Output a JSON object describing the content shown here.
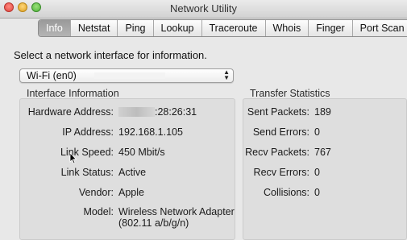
{
  "window": {
    "title": "Network Utility"
  },
  "tabs": [
    {
      "label": "Info",
      "active": true
    },
    {
      "label": "Netstat",
      "active": false
    },
    {
      "label": "Ping",
      "active": false
    },
    {
      "label": "Lookup",
      "active": false
    },
    {
      "label": "Traceroute",
      "active": false
    },
    {
      "label": "Whois",
      "active": false
    },
    {
      "label": "Finger",
      "active": false
    },
    {
      "label": "Port Scan",
      "active": false
    }
  ],
  "info": {
    "prompt": "Select a network interface for information.",
    "interface_select": {
      "value": "Wi-Fi (en0)"
    },
    "interface_section": {
      "title": "Interface Information",
      "hardware_address": {
        "label": "Hardware Address:",
        "value": ":28:26:31"
      },
      "ip_address": {
        "label": "IP Address:",
        "value": "192.168.1.105"
      },
      "link_speed": {
        "label": "Link Speed:",
        "value": "450 Mbit/s"
      },
      "link_status": {
        "label": "Link Status:",
        "value": "Active"
      },
      "vendor": {
        "label": "Vendor:",
        "value": "Apple"
      },
      "model": {
        "label": "Model:",
        "value_line1": "Wireless Network Adapter",
        "value_line2": "(802.11 a/b/g/n)"
      }
    },
    "transfer_section": {
      "title": "Transfer Statistics",
      "sent_packets": {
        "label": "Sent Packets:",
        "value": "189"
      },
      "send_errors": {
        "label": "Send Errors:",
        "value": "0"
      },
      "recv_packets": {
        "label": "Recv Packets:",
        "value": "767"
      },
      "recv_errors": {
        "label": "Recv Errors:",
        "value": "0"
      },
      "collisions": {
        "label": "Collisions:",
        "value": "0"
      }
    }
  },
  "icons": {
    "close": "close-button-icon",
    "minimize": "minimize-button-icon",
    "zoom": "zoom-button-icon",
    "select_arrows": "up-down-chevron-icon",
    "cursor": "mouse-pointer-icon"
  },
  "colors": {
    "close": "#e0443e",
    "minimize": "#dea123",
    "zoom": "#4fb53a",
    "active_tab": "#a6a6a6"
  }
}
